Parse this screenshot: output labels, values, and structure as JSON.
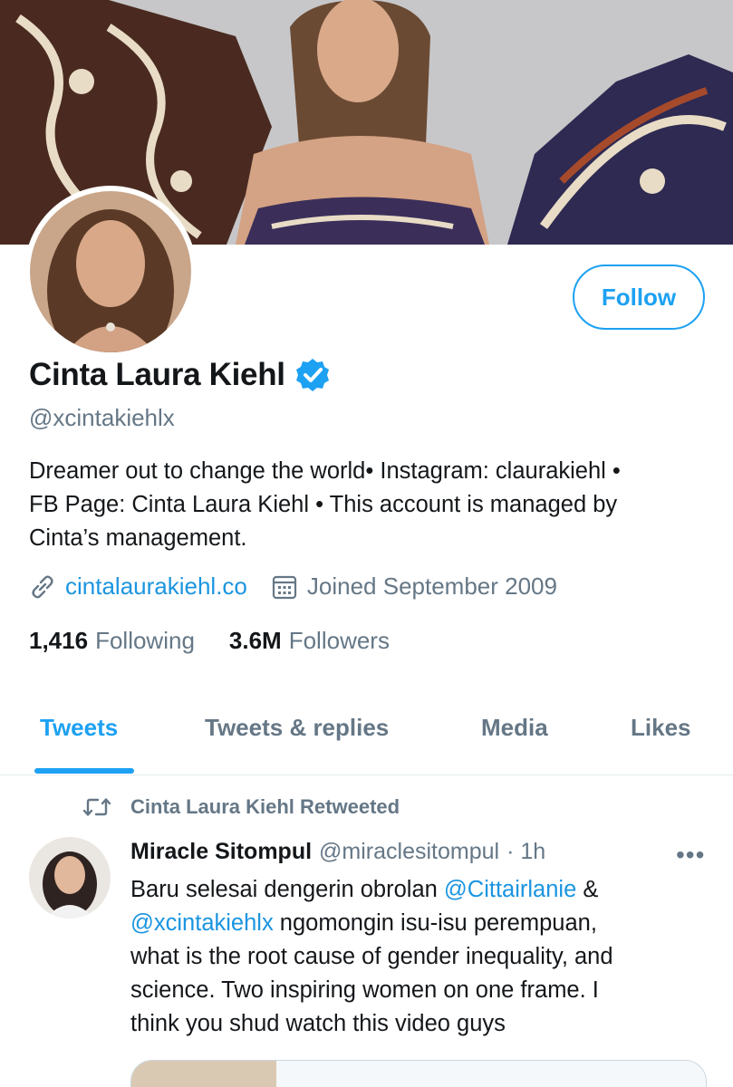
{
  "profile": {
    "display_name": "Cinta Laura Kiehl",
    "handle": "@xcintakiehlx",
    "verified": true,
    "bio_lines": [
      "Dreamer out to change the world• Instagram: claurakiehl •",
      "FB Page: Cinta Laura Kiehl • This account is managed by",
      "Cinta’s management."
    ],
    "website": "cintalaurakiehl.co",
    "joined": "Joined September 2009",
    "following_count": "1,416",
    "following_label": "Following",
    "followers_count": "3.6M",
    "followers_label": "Followers"
  },
  "actions": {
    "follow_label": "Follow"
  },
  "tabs": [
    {
      "label": "Tweets",
      "active": true
    },
    {
      "label": "Tweets & replies",
      "active": false
    },
    {
      "label": "Media",
      "active": false
    },
    {
      "label": "Likes",
      "active": false
    }
  ],
  "tweet": {
    "retweet_note": "Cinta Laura Kiehl Retweeted",
    "author_name": "Miracle Sitompul",
    "author_handle": "@miraclesitompul",
    "time": "· 1h",
    "more": "•••",
    "body": {
      "t1": "Baru selesai dengerin obrolan ",
      "m1": "@Cittairlanie",
      "t2": " &",
      "m2": "@xcintakiehlx",
      "t3": " ngomongin isu-isu perempuan,",
      "t4": "what is the root cause of gender inequality, and",
      "t5": "science. Two inspiring women on one frame. I",
      "t6": "think you shud watch this video guys"
    }
  },
  "colors": {
    "accent": "#1da1f2",
    "link": "#1b95e0",
    "secondary_text": "#657786",
    "primary_text": "#14171a"
  },
  "icons": [
    "verified-badge-icon",
    "link-icon",
    "calendar-icon",
    "retweet-icon",
    "more-icon"
  ]
}
